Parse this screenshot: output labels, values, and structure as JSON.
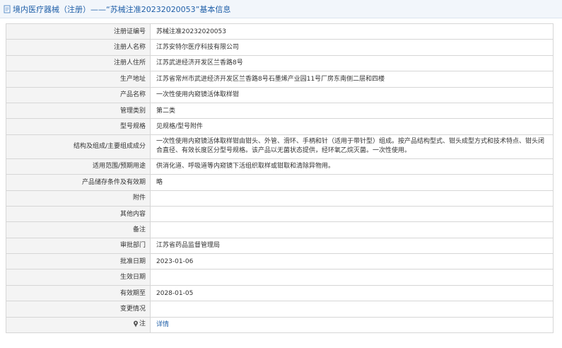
{
  "header": {
    "title": "境内医疗器械（注册）——“苏械注准20232020053”基本信息"
  },
  "rows": [
    {
      "label": "注册证编号",
      "value": "苏械注准20232020053"
    },
    {
      "label": "注册人名称",
      "value": "江苏安特尔医疗科技有限公司"
    },
    {
      "label": "注册人住所",
      "value": "江苏武进经济开发区兰香路8号"
    },
    {
      "label": "生产地址",
      "value": "江苏省常州市武进经济开发区兰香路8号石墨烯产业园11号厂房东南侧二层和四楼"
    },
    {
      "label": "产品名称",
      "value": "一次性使用内窥镜活体取样钳"
    },
    {
      "label": "管理类别",
      "value": "第二类"
    },
    {
      "label": "型号规格",
      "value": "见规格/型号附件"
    },
    {
      "label": "结构及组成/主要组成成分",
      "value": "一次性使用内窥镜活体取样钳由钳头、外管、滑环、手柄和针（适用于带针型）组成。按产品结构型式、钳头成型方式和技术特点、钳头闭合直径、有效长度区分型号规格。该产品以无菌状态提供，经环氧乙烷灭菌。一次性使用。"
    },
    {
      "label": "适用范围/预期用途",
      "value": "供消化道、呼吸道等内窥镜下活组织取样或钳取和清除异物用。"
    },
    {
      "label": "产品储存条件及有效期",
      "value": "略"
    },
    {
      "label": "附件",
      "value": ""
    },
    {
      "label": "其他内容",
      "value": ""
    },
    {
      "label": "备注",
      "value": ""
    },
    {
      "label": "审批部门",
      "value": "江苏省药品监督管理局"
    },
    {
      "label": "批准日期",
      "value": "2023-01-06"
    },
    {
      "label": "生效日期",
      "value": ""
    },
    {
      "label": "有效期至",
      "value": "2028-01-05"
    },
    {
      "label": "变更情况",
      "value": ""
    }
  ],
  "note_row": {
    "label": "注",
    "icon": "pin-icon",
    "link_text": "详情"
  },
  "colors": {
    "title": "#1f5fa8",
    "link": "#1f5fa8",
    "label_bg": "#f4f4f4",
    "border": "#d6d6d6"
  }
}
